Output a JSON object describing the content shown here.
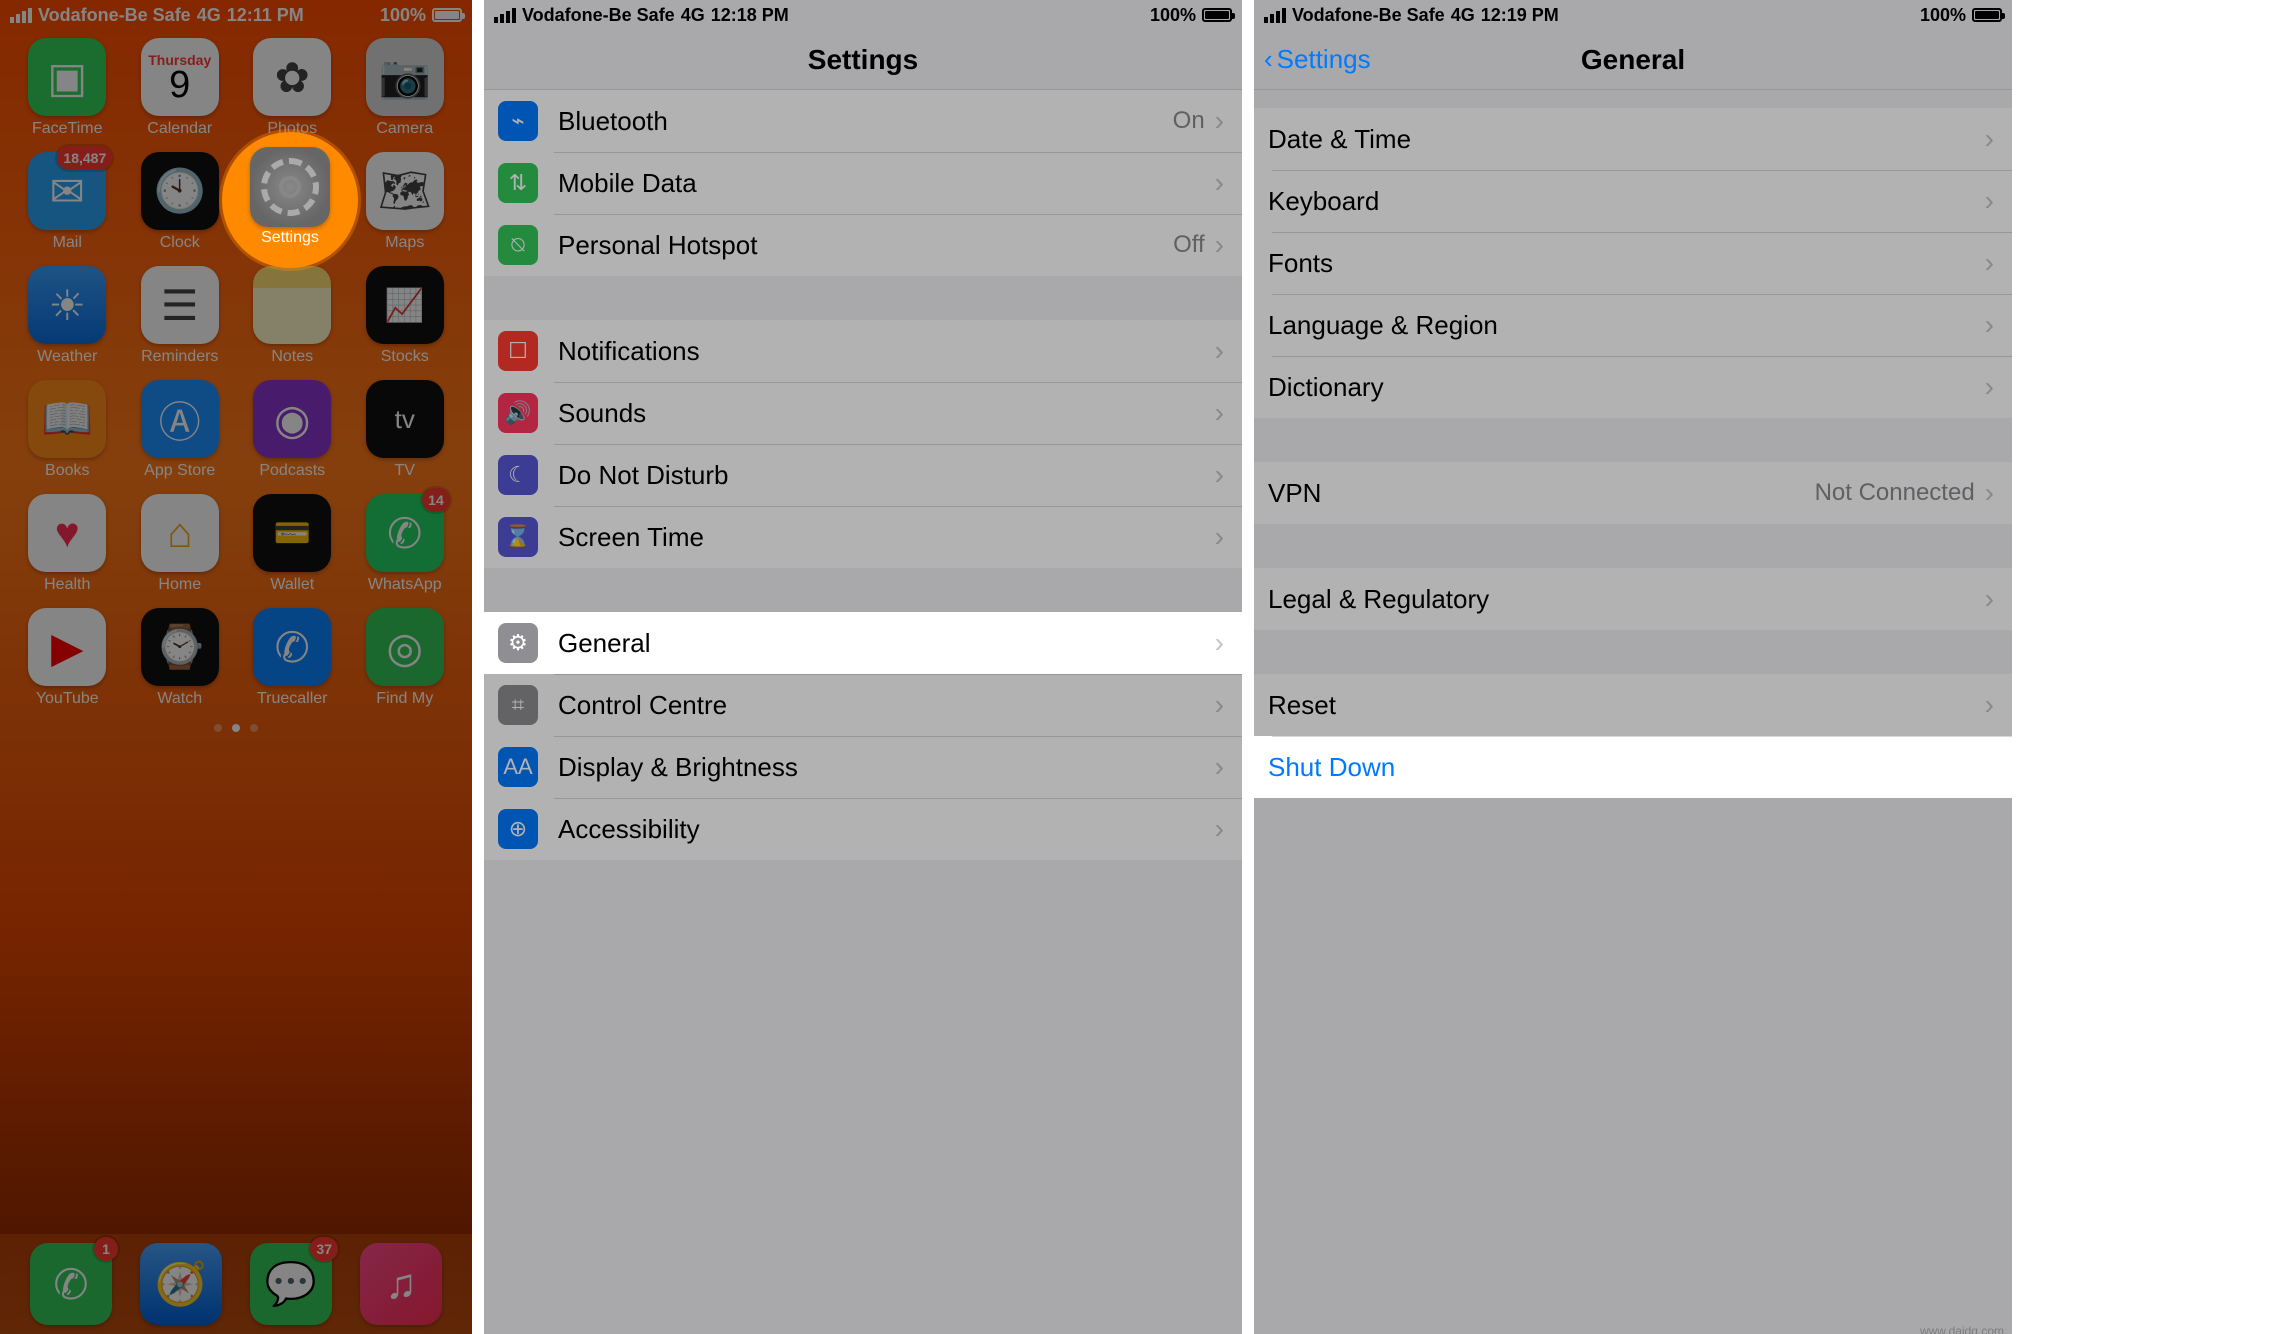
{
  "status": {
    "carrier": "Vodafone-Be Safe",
    "network": "4G",
    "battery": "100%"
  },
  "times": {
    "p1": "12:11 PM",
    "p2": "12:18 PM",
    "p3": "12:19 PM"
  },
  "home": {
    "spotlight_label": "Settings",
    "calendar_day": "Thursday",
    "calendar_num": "9",
    "apps": [
      {
        "label": "FaceTime"
      },
      {
        "label": "Calendar"
      },
      {
        "label": "Photos"
      },
      {
        "label": "Camera"
      },
      {
        "label": "Mail",
        "badge": "18,487"
      },
      {
        "label": "Clock"
      },
      {
        "label": "Settings"
      },
      {
        "label": "Maps"
      },
      {
        "label": "Weather"
      },
      {
        "label": "Reminders"
      },
      {
        "label": "Notes"
      },
      {
        "label": "Stocks"
      },
      {
        "label": "Books"
      },
      {
        "label": "App Store"
      },
      {
        "label": "Podcasts"
      },
      {
        "label": "TV"
      },
      {
        "label": "Health"
      },
      {
        "label": "Home"
      },
      {
        "label": "Wallet"
      },
      {
        "label": "WhatsApp",
        "badge": "14"
      },
      {
        "label": "YouTube"
      },
      {
        "label": "Watch"
      },
      {
        "label": "Truecaller"
      },
      {
        "label": "Find My"
      }
    ],
    "dock": [
      {
        "label": "Phone",
        "badge": "1"
      },
      {
        "label": "Safari"
      },
      {
        "label": "Messages",
        "badge": "37"
      },
      {
        "label": "Music"
      }
    ]
  },
  "settings": {
    "title": "Settings",
    "rows": [
      {
        "label": "Bluetooth",
        "value": "On"
      },
      {
        "label": "Mobile Data"
      },
      {
        "label": "Personal Hotspot",
        "value": "Off"
      },
      {
        "label": "Notifications"
      },
      {
        "label": "Sounds"
      },
      {
        "label": "Do Not Disturb"
      },
      {
        "label": "Screen Time"
      },
      {
        "label": "General"
      },
      {
        "label": "Control Centre"
      },
      {
        "label": "Display & Brightness"
      },
      {
        "label": "Accessibility"
      }
    ]
  },
  "general": {
    "back": "Settings",
    "title": "General",
    "rows": [
      {
        "label": "Date & Time"
      },
      {
        "label": "Keyboard"
      },
      {
        "label": "Fonts"
      },
      {
        "label": "Language & Region"
      },
      {
        "label": "Dictionary"
      },
      {
        "label": "VPN",
        "value": "Not Connected"
      },
      {
        "label": "Legal & Regulatory"
      },
      {
        "label": "Reset"
      },
      {
        "label": "Shut Down"
      }
    ]
  },
  "watermark": "www.daidq.com"
}
